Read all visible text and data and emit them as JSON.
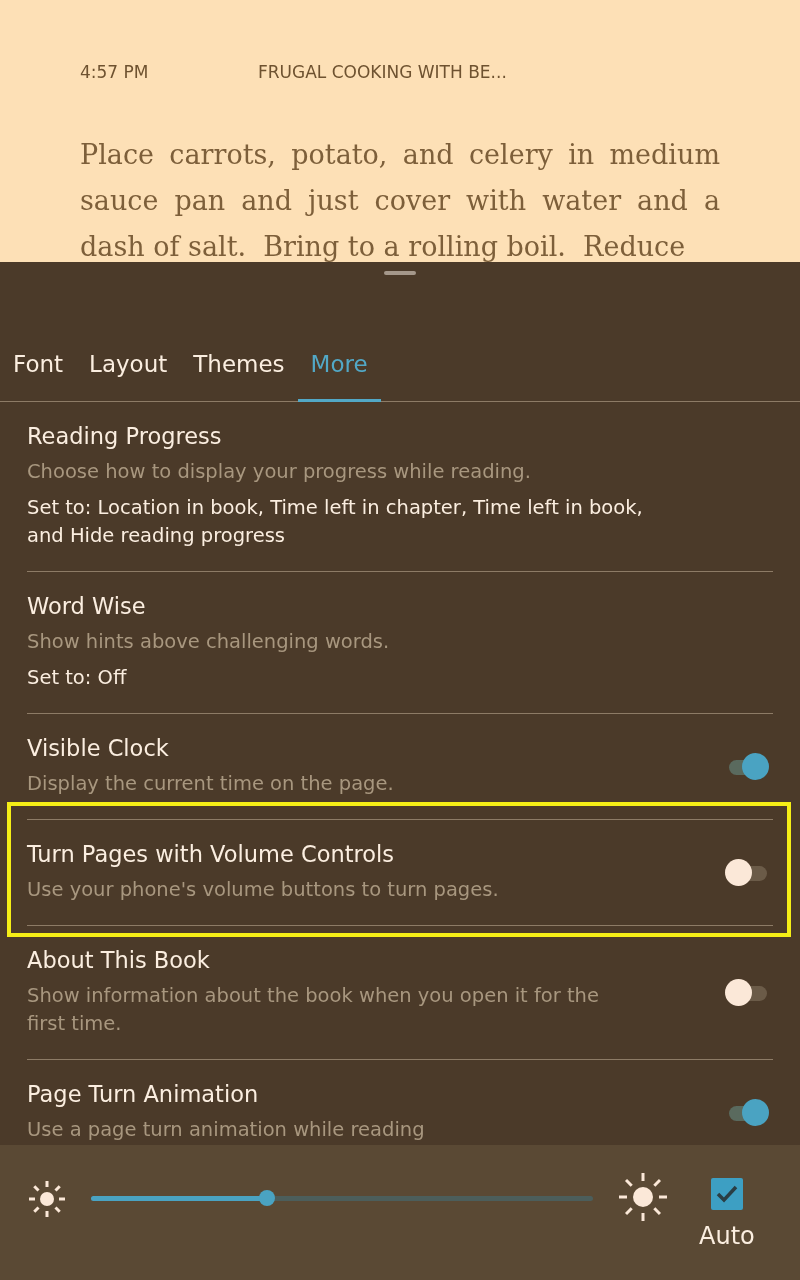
{
  "reader": {
    "clock": "4:57 PM",
    "book_title": "FRUGAL COOKING WITH BE...",
    "paragraph": "Place carrots, potato, and celery in medium sauce pan and just cover with water and a dash of salt.  Bring to a rolling boil.  Reduce"
  },
  "tabs": [
    {
      "label": "Font",
      "selected": false
    },
    {
      "label": "Layout",
      "selected": false
    },
    {
      "label": "Themes",
      "selected": false
    },
    {
      "label": "More",
      "selected": true
    }
  ],
  "settings": [
    {
      "kind": "info",
      "title": "Reading Progress",
      "description": "Choose how to display your progress while reading.",
      "value": "Set to: Location in book, Time left in chapter, Time left in book, and Hide reading progress",
      "highlighted": false
    },
    {
      "kind": "info",
      "title": "Word Wise",
      "description": "Show hints above challenging words.",
      "value": "Set to: Off",
      "highlighted": false
    },
    {
      "kind": "toggle",
      "title": "Visible Clock",
      "description": "Display the current time on the page.",
      "on": true,
      "highlighted": false
    },
    {
      "kind": "toggle",
      "title": "Turn Pages with Volume Controls",
      "description": "Use your phone's volume buttons to turn pages.",
      "on": false,
      "highlighted": true
    },
    {
      "kind": "toggle",
      "title": "About This Book",
      "description": "Show information about the book when you open it for the first time.",
      "on": false,
      "highlighted": false
    },
    {
      "kind": "toggle",
      "title": "Page Turn Animation",
      "description": "Use a page turn animation while reading",
      "on": true,
      "highlighted": false
    }
  ],
  "brightness": {
    "level": 0.35,
    "auto": {
      "label": "Auto",
      "checked": true
    }
  }
}
